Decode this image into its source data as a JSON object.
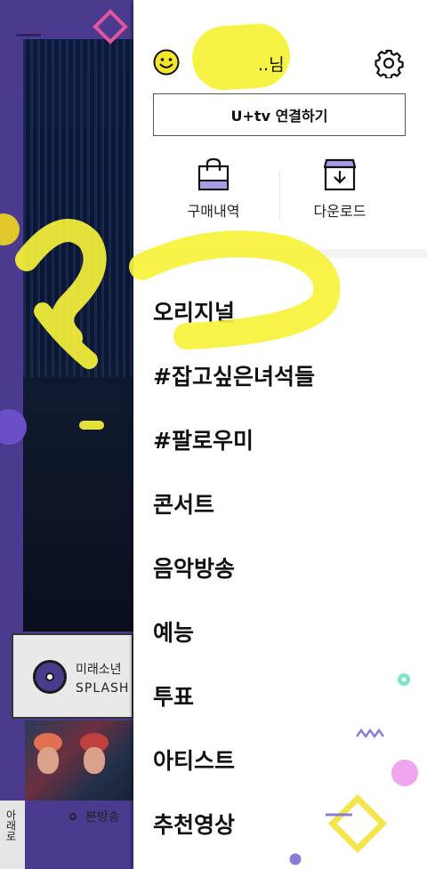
{
  "background": {
    "track_artist": "미래소년",
    "track_title": "SPLASH",
    "live_label": "본방송",
    "side_label": "아래로"
  },
  "drawer": {
    "username_suffix": "..님",
    "connect_button": "U+tv 연결하기",
    "quick_actions": [
      {
        "label": "구매내역",
        "icon": "shopping-bag-icon"
      },
      {
        "label": "다운로드",
        "icon": "download-box-icon"
      }
    ],
    "menu": [
      "오리지널",
      "#잡고싶은녀석들",
      "#팔로우미",
      "콘서트",
      "음악방송",
      "예능",
      "투표",
      "아티스트",
      "추천영상"
    ]
  },
  "colors": {
    "accent_purple": "#4a3b8f",
    "highlighter_yellow": "#f7f23a",
    "icon_lavender": "#a99be6"
  }
}
